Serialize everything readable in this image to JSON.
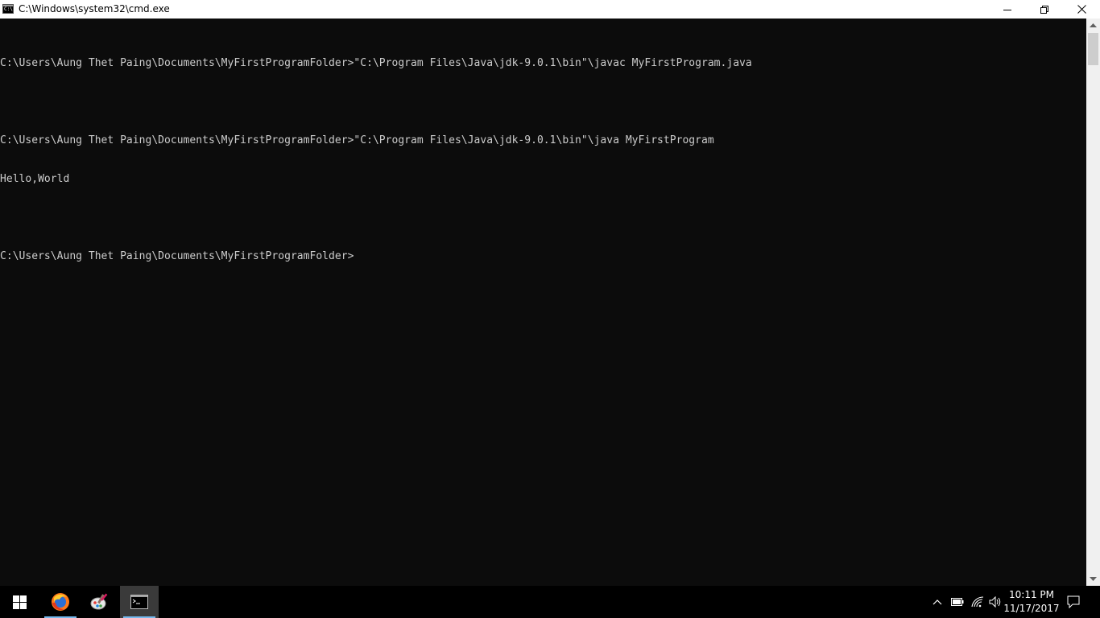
{
  "window": {
    "title": "C:\\Windows\\system32\\cmd.exe",
    "icon": "cmd-icon",
    "icon_text": "C:\\",
    "controls": {
      "minimize": "minimize-icon",
      "restore": "restore-icon",
      "close": "close-icon"
    }
  },
  "console": {
    "background": "#0c0c0c",
    "foreground": "#cccccc",
    "lines": [
      "C:\\Users\\Aung Thet Paing\\Documents\\MyFirstProgramFolder>\"C:\\Program Files\\Java\\jdk-9.0.1\\bin\"\\javac MyFirstProgram.java",
      "",
      "C:\\Users\\Aung Thet Paing\\Documents\\MyFirstProgramFolder>\"C:\\Program Files\\Java\\jdk-9.0.1\\bin\"\\java MyFirstProgram",
      "Hello,World",
      "",
      "C:\\Users\\Aung Thet Paing\\Documents\\MyFirstProgramFolder>"
    ]
  },
  "taskbar": {
    "start": "windows-start-icon",
    "pinned": [
      {
        "name": "firefox-icon",
        "active": false,
        "running": true
      },
      {
        "name": "paint-icon",
        "active": false,
        "running": false
      },
      {
        "name": "cmd-icon",
        "active": true,
        "running": true
      }
    ],
    "tray": {
      "chevron": "chevron-up-icon",
      "battery": "battery-icon",
      "network": "wifi-icon",
      "volume": "volume-icon",
      "notifications": "action-center-icon"
    },
    "clock": {
      "time": "10:11 PM",
      "date": "11/17/2017"
    }
  },
  "colors": {
    "titlebar": "#ffffff",
    "taskbar": "#000000",
    "taskbar_active": "#3a3a3a",
    "accent": "#76b9ed",
    "scrollbar_track": "#f0f0f0",
    "scrollbar_thumb": "#cdcdcd"
  }
}
